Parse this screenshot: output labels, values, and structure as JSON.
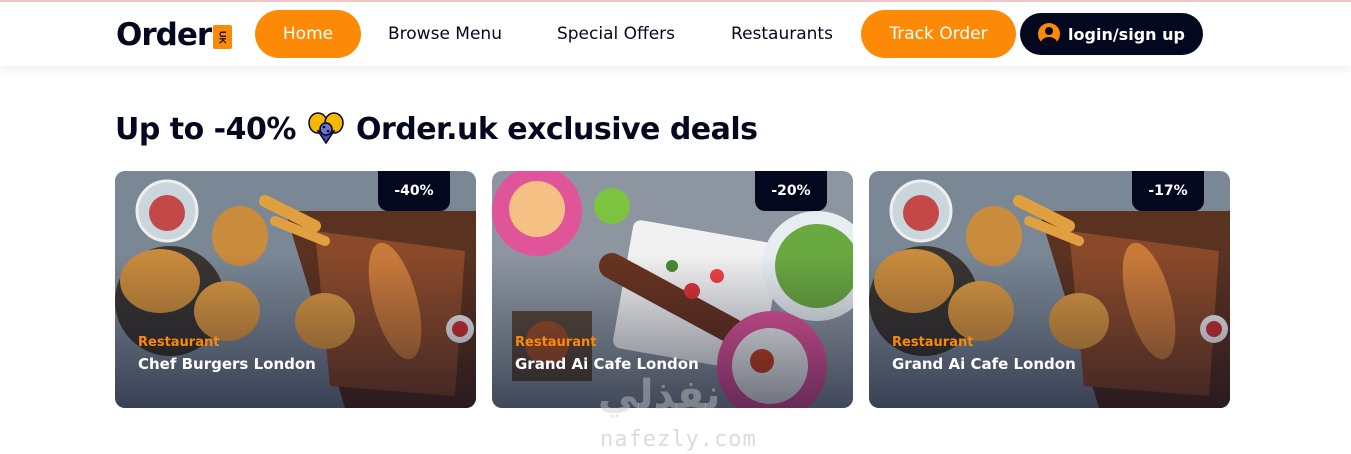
{
  "brand": {
    "name": "Order",
    "badge": "UK"
  },
  "nav": {
    "home": "Home",
    "browse": "Browse Menu",
    "offers": "Special Offers",
    "restaurants": "Restaurants",
    "track": "Track Order",
    "login": "login/sign up"
  },
  "section": {
    "title_prefix": "Up to -40%",
    "title_suffix": "Order.uk exclusive deals"
  },
  "deals": [
    {
      "discount": "-40%",
      "category": "Restaurant",
      "name": "Chef Burgers London"
    },
    {
      "discount": "-20%",
      "category": "Restaurant",
      "name": "Grand Ai Cafe London"
    },
    {
      "discount": "-17%",
      "category": "Restaurant",
      "name": "Grand Ai Cafe London"
    }
  ],
  "watermark": {
    "arabic": "نفذلي",
    "latin": "nafezly.com"
  },
  "colors": {
    "accent": "#fc8a06",
    "dark": "#03081f"
  }
}
